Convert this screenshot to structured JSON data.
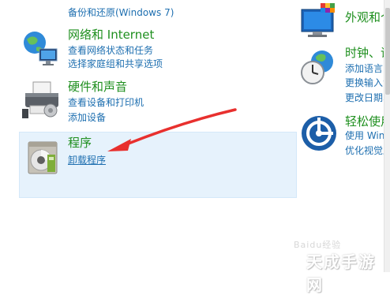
{
  "left": {
    "system": {
      "backup_link": "备份和还原(Windows 7)"
    },
    "network": {
      "title": "网络和 Internet",
      "links": [
        "查看网络状态和任务",
        "选择家庭组和共享选项"
      ]
    },
    "hardware": {
      "title": "硬件和声音",
      "links": [
        "查看设备和打印机",
        "添加设备"
      ]
    },
    "programs": {
      "title": "程序",
      "links": [
        "卸载程序"
      ]
    }
  },
  "right": {
    "appearance": {
      "title": "外观和个"
    },
    "clock": {
      "title": "时钟、语",
      "links": [
        "添加语言",
        "更换输入法",
        "更改日期、"
      ]
    },
    "ease": {
      "title": "轻松使用",
      "links": [
        "使用 Wind",
        "优化视觉显"
      ]
    }
  },
  "watermark": {
    "text": "Baidu经验",
    "brand": "天成手游网"
  },
  "colors": {
    "title_green": "#1e8f1e",
    "link_blue": "#1e6fb0",
    "highlight": "#e6f2fc",
    "arrow_red": "#e8302e"
  },
  "icons": {
    "network": "network-globe-icon",
    "hardware": "printer-icon",
    "programs": "program-disc-icon",
    "appearance": "monitor-palette-icon",
    "clock": "clock-globe-icon",
    "ease": "ease-of-access-icon",
    "shield": "shield-icon"
  }
}
